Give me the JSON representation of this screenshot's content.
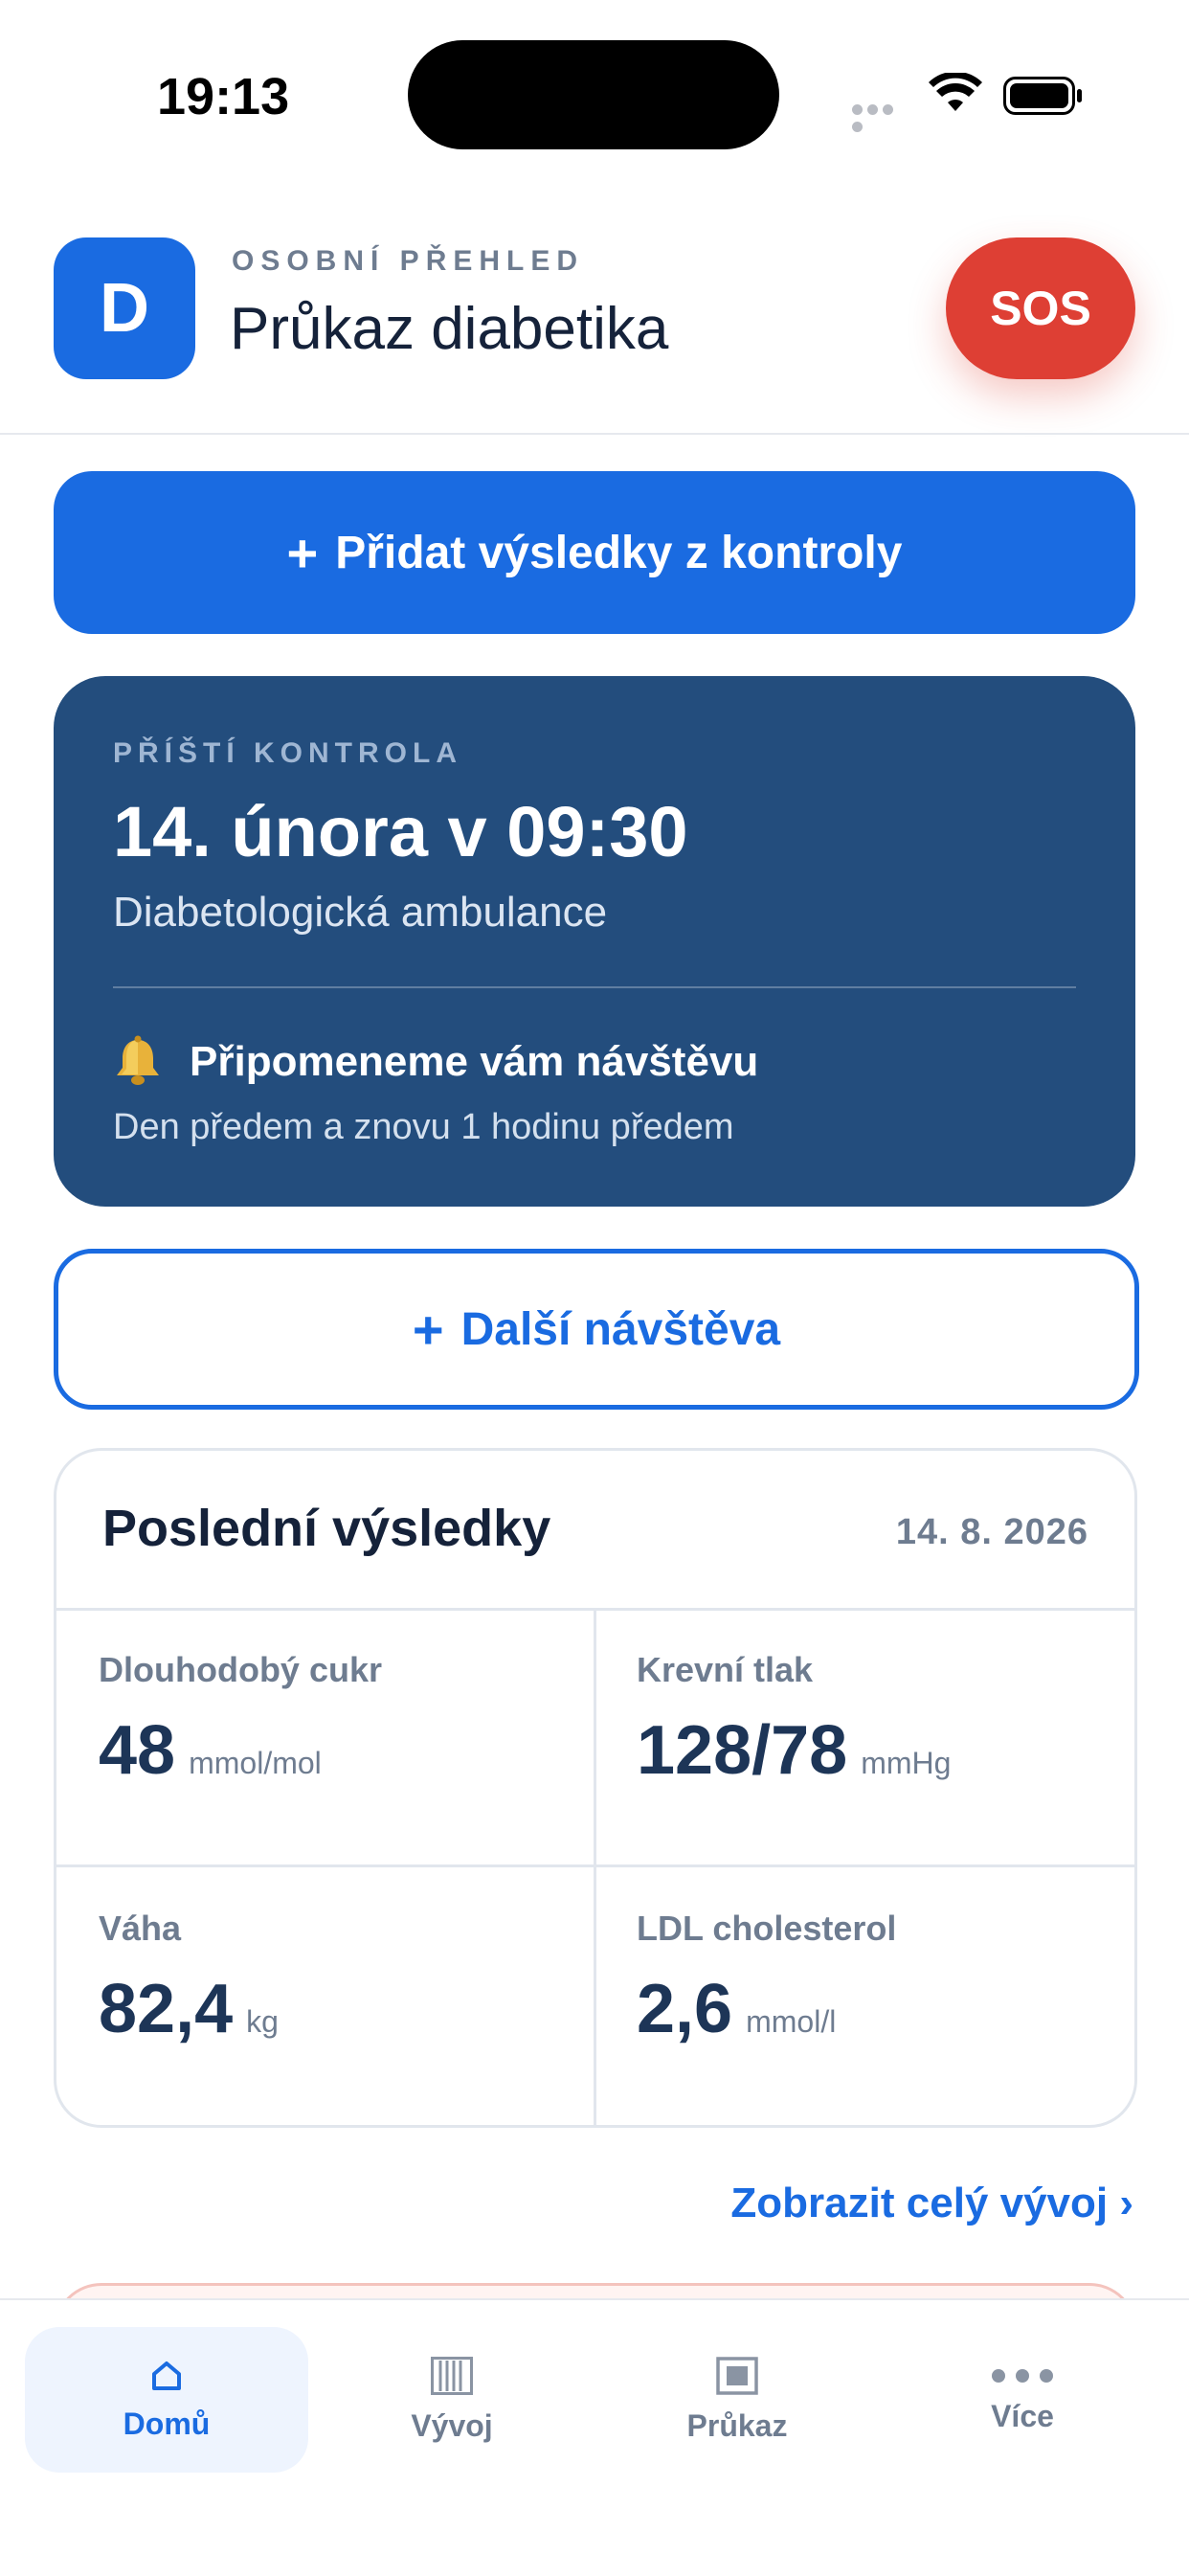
{
  "status_bar": {
    "time": "19:13"
  },
  "header": {
    "avatar_letter": "D",
    "eyebrow": "OSOBNÍ PŘEHLED",
    "title": "Průkaz diabetika",
    "sos_label": "SOS"
  },
  "actions": {
    "add_results_label": "Přidat výsledky z kontroly",
    "add_visit_label": "Další návštěva",
    "plus_glyph": "+"
  },
  "next_check": {
    "eyebrow": "PŘÍŠTÍ KONTROLA",
    "datetime": "14. února v 09:30",
    "place": "Diabetologická ambulance",
    "reminder_title": "Připomeneme vám návštěvu",
    "reminder_detail": "Den předem a znovu 1 hodinu předem",
    "reminder_icon": "bell-icon"
  },
  "results": {
    "title": "Poslední výsledky",
    "date": "14. 8. 2026",
    "metrics": [
      {
        "label": "Dlouhodobý cukr",
        "value": "48",
        "unit": "mmol/mol"
      },
      {
        "label": "Krevní tlak",
        "value": "128/78",
        "unit": "mmHg"
      },
      {
        "label": "Váha",
        "value": "82,4",
        "unit": "kg"
      },
      {
        "label": "LDL cholesterol",
        "value": "2,6",
        "unit": "mmol/l"
      }
    ],
    "show_all_label": "Zobrazit celý vývoj ›"
  },
  "tabbar": {
    "items": [
      {
        "label": "Domů",
        "icon": "home-icon",
        "active": true
      },
      {
        "label": "Vývoj",
        "icon": "chart-bars-icon",
        "active": false
      },
      {
        "label": "Průkaz",
        "icon": "card-icon",
        "active": false
      },
      {
        "label": "Více",
        "icon": "more-dots-icon",
        "active": false
      }
    ]
  },
  "colors": {
    "accent": "#1a6be1",
    "card_dark": "#234d7d",
    "sos": "#de3f34",
    "text_muted": "#6e7c90"
  }
}
